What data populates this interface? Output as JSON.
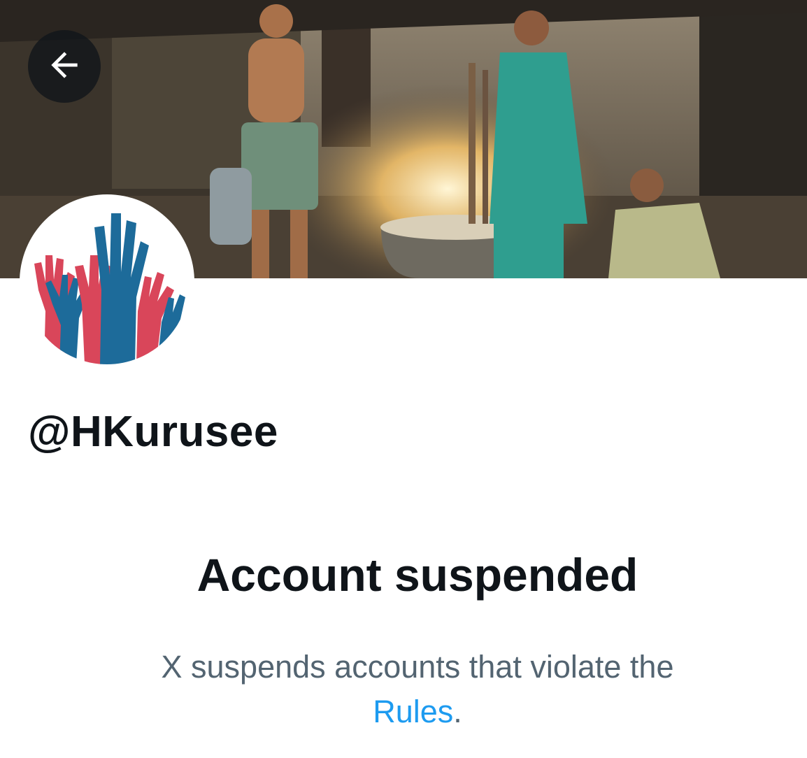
{
  "header": {
    "back_icon": "arrow-left-icon"
  },
  "banner": {
    "description_icon": "cover-photo"
  },
  "profile": {
    "avatar_icon": "raised-hands-logo",
    "handle": "@HKurusee"
  },
  "notice": {
    "title": "Account suspended",
    "message": "X suspends accounts that violate the",
    "link_label": "Rules",
    "punctuation": "."
  },
  "colors": {
    "text_primary": "#0f1419",
    "text_secondary": "#536471",
    "link": "#1d9bf0",
    "logo_blue": "#1d6b9a",
    "logo_red": "#d9465a"
  }
}
